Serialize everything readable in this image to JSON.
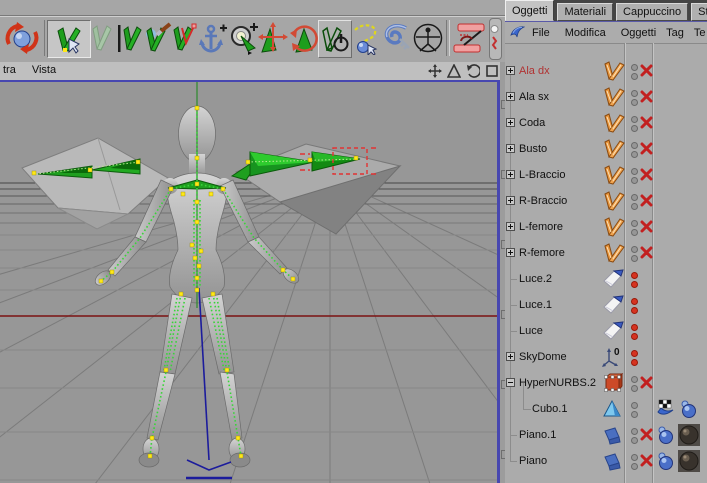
{
  "toolbar": {
    "tools": [
      {
        "name": "revert-sphere"
      },
      {
        "name": "bone-tool",
        "active": true
      },
      {
        "name": "bone-ghost"
      },
      {
        "name": "mirror-bone"
      },
      {
        "name": "claude-bone-paint"
      },
      {
        "name": "bone-ik"
      },
      {
        "name": "anchor-add"
      },
      {
        "name": "target-add"
      },
      {
        "name": "move-joint"
      },
      {
        "name": "rotate-joint"
      },
      {
        "name": "bone-power",
        "active": true
      },
      {
        "name": "cappuccino-path"
      },
      {
        "name": "keyframe-key"
      },
      {
        "name": "character-circle"
      },
      {
        "name": "soft-spring"
      }
    ]
  },
  "viewport": {
    "menu_items": [
      "tra",
      "Vista"
    ],
    "controls": [
      {
        "name": "pan-view"
      },
      {
        "name": "zoom-view"
      },
      {
        "name": "rotate-view"
      },
      {
        "name": "maximize-view"
      }
    ],
    "scene": "humanoid figure with wings, green bone rig, yellow joints"
  },
  "panel": {
    "tabs": [
      {
        "label": "Oggetti",
        "active": true
      },
      {
        "label": "Materiali",
        "active": false
      },
      {
        "label": "Cappuccino",
        "active": false
      },
      {
        "label": "Struttu",
        "active": false
      }
    ],
    "menu_items": [
      "File",
      "Modifica",
      "Oggetti",
      "Tag",
      "Te"
    ],
    "objects": [
      {
        "name": "Ala dx",
        "selected": true,
        "box": "plus",
        "icon": "bone",
        "dots": "gray",
        "x": true,
        "tags": []
      },
      {
        "name": "Ala sx",
        "selected": false,
        "box": "plus",
        "icon": "bone",
        "dots": "gray",
        "x": true,
        "tags": []
      },
      {
        "name": "Coda",
        "selected": false,
        "box": "plus",
        "icon": "bone",
        "dots": "gray",
        "x": true,
        "tags": []
      },
      {
        "name": "Busto",
        "selected": false,
        "box": "plus",
        "icon": "bone",
        "dots": "gray",
        "x": true,
        "tags": []
      },
      {
        "name": "L-Braccio",
        "selected": false,
        "box": "plus",
        "icon": "bone",
        "dots": "gray",
        "x": true,
        "tags": []
      },
      {
        "name": "R-Braccio",
        "selected": false,
        "box": "plus",
        "icon": "bone",
        "dots": "gray",
        "x": true,
        "tags": []
      },
      {
        "name": "L-femore",
        "selected": false,
        "box": "plus",
        "icon": "bone",
        "dots": "gray",
        "x": true,
        "tags": []
      },
      {
        "name": "R-femore",
        "selected": false,
        "box": "plus",
        "icon": "bone",
        "dots": "gray",
        "x": true,
        "tags": []
      },
      {
        "name": "Luce.2",
        "selected": false,
        "box": "leaf",
        "icon": "light",
        "dots": "red",
        "x": false,
        "tags": []
      },
      {
        "name": "Luce.1",
        "selected": false,
        "box": "leaf",
        "icon": "light",
        "dots": "red",
        "x": false,
        "tags": []
      },
      {
        "name": "Luce",
        "selected": false,
        "box": "leaf",
        "icon": "light",
        "dots": "red",
        "x": false,
        "tags": []
      },
      {
        "name": "SkyDome",
        "selected": false,
        "box": "plus",
        "icon": "skydome",
        "dots": "red",
        "x": false,
        "tags": []
      },
      {
        "name": "HyperNURBS.2",
        "selected": false,
        "box": "minus",
        "icon": "hypernurbs",
        "dots": "gray",
        "x": true,
        "tags": []
      },
      {
        "name": "Cubo.1",
        "selected": false,
        "box": "child",
        "icon": "pyramid",
        "dots": "gray",
        "x": false,
        "tags": [
          "checker",
          "phong"
        ]
      },
      {
        "name": "Piano.1",
        "selected": false,
        "box": "leaf",
        "icon": "plane",
        "dots": "gray",
        "x": true,
        "tags": [
          "phong",
          "material"
        ]
      },
      {
        "name": "Piano",
        "selected": false,
        "box": "leaf",
        "icon": "plane",
        "dots": "gray",
        "x": true,
        "tags": [
          "phong",
          "material"
        ]
      }
    ]
  },
  "colors": {
    "accent_blue": "#4747b0",
    "selected_red": "#b03232",
    "bone_orange": "#e0913c",
    "rig_green": "#22aa22",
    "joint_yellow": "#ffe818",
    "x_red": "#c22020",
    "panel_gray": "#ababab",
    "viewport_gray": "#979797"
  }
}
